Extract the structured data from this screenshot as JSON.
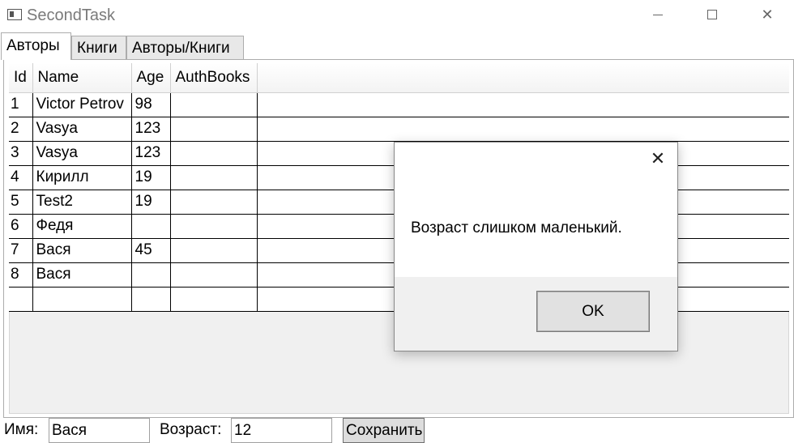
{
  "window": {
    "title": "SecondTask",
    "app_icon": "window-app-icon",
    "minimize_icon": "minimize-icon",
    "maximize_icon": "maximize-icon",
    "close_icon": "close-icon"
  },
  "tabs": [
    {
      "label": "Авторы",
      "active": true
    },
    {
      "label": "Книги",
      "active": false
    },
    {
      "label": "Авторы/Книги",
      "active": false
    }
  ],
  "grid": {
    "columns": [
      "Id",
      "Name",
      "Age",
      "AuthBooks"
    ],
    "rows": [
      [
        "1",
        "Victor Petrov",
        "98",
        ""
      ],
      [
        "2",
        "Vasya",
        "123",
        ""
      ],
      [
        "3",
        "Vasya",
        "123",
        ""
      ],
      [
        "4",
        "Кирилл",
        "19",
        ""
      ],
      [
        "5",
        "Test2",
        "19",
        ""
      ],
      [
        "6",
        "Федя",
        "",
        ""
      ],
      [
        "7",
        "Вася",
        "45",
        ""
      ],
      [
        "8",
        "Вася",
        "",
        ""
      ],
      [
        "",
        "",
        "",
        ""
      ]
    ]
  },
  "form": {
    "name_label": "Имя:",
    "name_value": "Вася",
    "age_label": "Возраст:",
    "age_value": "12",
    "save_label": "Сохранить"
  },
  "dialog": {
    "message": "Возраст слишком маленький.",
    "ok_label": "OK",
    "close_icon": "close-icon"
  }
}
